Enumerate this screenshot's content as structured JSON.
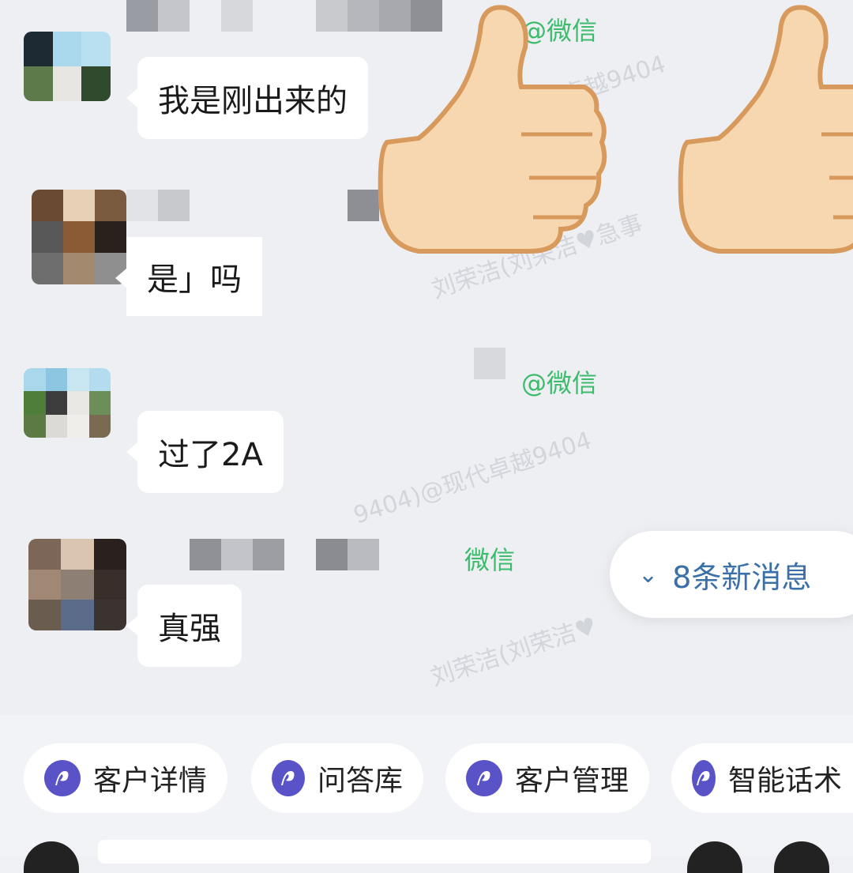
{
  "messages": [
    {
      "text": "我是刚出来的",
      "tag": "@微信"
    },
    {
      "text": "是」吗",
      "tag": ""
    },
    {
      "text": "过了2A",
      "tag": "@微信"
    },
    {
      "text": "真强",
      "tag": "微信"
    }
  ],
  "new_messages": {
    "label": "8条新消息",
    "icon": "chevron-double-down-icon"
  },
  "toolbar": {
    "items": [
      {
        "label": "客户详情",
        "icon": "assistant-logo-icon"
      },
      {
        "label": "问答库",
        "icon": "assistant-logo-icon"
      },
      {
        "label": "客户管理",
        "icon": "assistant-logo-icon"
      },
      {
        "label": "智能话术",
        "icon": "assistant-logo-icon"
      }
    ]
  },
  "watermarks": [
    "刘荣洁(刘荣洁♥急事",
    "9404)@现代卓越9404",
    "刘荣洁(刘荣洁♥",
    "@现代卓越9404"
  ],
  "colors": {
    "chat_bg": "#edeff3",
    "tag_green": "#3dbb6c",
    "accent_blue": "#3a6fa8",
    "icon_purple": "#5a52c7"
  }
}
